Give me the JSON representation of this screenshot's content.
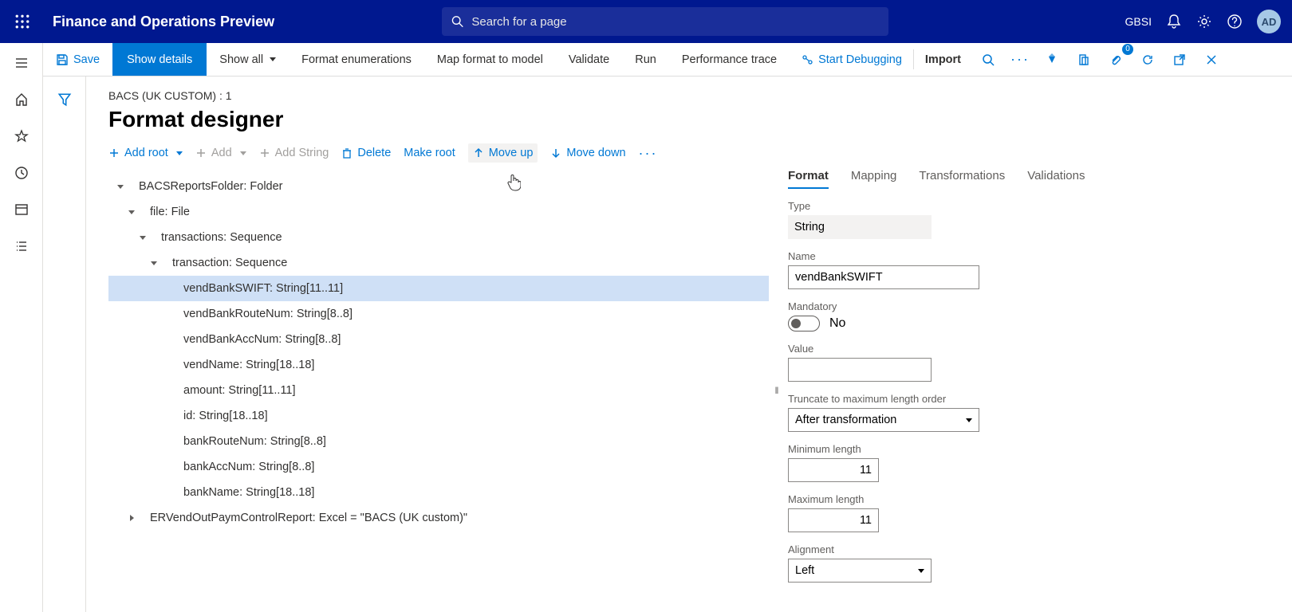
{
  "header": {
    "app_title": "Finance and Operations Preview",
    "search_placeholder": "Search for a page",
    "company": "GBSI",
    "avatar_initials": "AD"
  },
  "action_bar": {
    "save": "Save",
    "show_details": "Show details",
    "show_all": "Show all",
    "format_enum": "Format enumerations",
    "map_format": "Map format to model",
    "validate": "Validate",
    "run": "Run",
    "perf_trace": "Performance trace",
    "start_debug": "Start Debugging",
    "import": "Import",
    "attach_badge": "0"
  },
  "page": {
    "breadcrumb": "BACS (UK CUSTOM) : 1",
    "title": "Format designer"
  },
  "toolbar": {
    "add_root": "Add root",
    "add": "Add",
    "add_string": "Add String",
    "delete": "Delete",
    "make_root": "Make root",
    "move_up": "Move up",
    "move_down": "Move down"
  },
  "tree": [
    {
      "indent": 0,
      "caret": "down",
      "label": "BACSReportsFolder: Folder",
      "selected": false
    },
    {
      "indent": 1,
      "caret": "down",
      "label": "file: File",
      "selected": false
    },
    {
      "indent": 2,
      "caret": "down",
      "label": "transactions: Sequence",
      "selected": false
    },
    {
      "indent": 3,
      "caret": "down",
      "label": "transaction: Sequence",
      "selected": false
    },
    {
      "indent": 4,
      "caret": "none",
      "label": "vendBankSWIFT: String[11..11]",
      "selected": true
    },
    {
      "indent": 4,
      "caret": "none",
      "label": "vendBankRouteNum: String[8..8]",
      "selected": false
    },
    {
      "indent": 4,
      "caret": "none",
      "label": "vendBankAccNum: String[8..8]",
      "selected": false
    },
    {
      "indent": 4,
      "caret": "none",
      "label": "vendName: String[18..18]",
      "selected": false
    },
    {
      "indent": 4,
      "caret": "none",
      "label": "amount: String[11..11]",
      "selected": false
    },
    {
      "indent": 4,
      "caret": "none",
      "label": "id: String[18..18]",
      "selected": false
    },
    {
      "indent": 4,
      "caret": "none",
      "label": "bankRouteNum: String[8..8]",
      "selected": false
    },
    {
      "indent": 4,
      "caret": "none",
      "label": "bankAccNum: String[8..8]",
      "selected": false
    },
    {
      "indent": 4,
      "caret": "none",
      "label": "bankName: String[18..18]",
      "selected": false
    },
    {
      "indent": 1,
      "caret": "right",
      "label": "ERVendOutPaymControlReport: Excel = \"BACS (UK custom)\"",
      "selected": false
    }
  ],
  "props": {
    "tabs": {
      "format": "Format",
      "mapping": "Mapping",
      "transformations": "Transformations",
      "validations": "Validations"
    },
    "fields": {
      "type_label": "Type",
      "type_value": "String",
      "name_label": "Name",
      "name_value": "vendBankSWIFT",
      "mandatory_label": "Mandatory",
      "mandatory_text": "No",
      "value_label": "Value",
      "value_value": "",
      "trunc_label": "Truncate to maximum length order",
      "trunc_value": "After transformation",
      "min_label": "Minimum length",
      "min_value": "11",
      "max_label": "Maximum length",
      "max_value": "11",
      "align_label": "Alignment",
      "align_value": "Left"
    }
  }
}
